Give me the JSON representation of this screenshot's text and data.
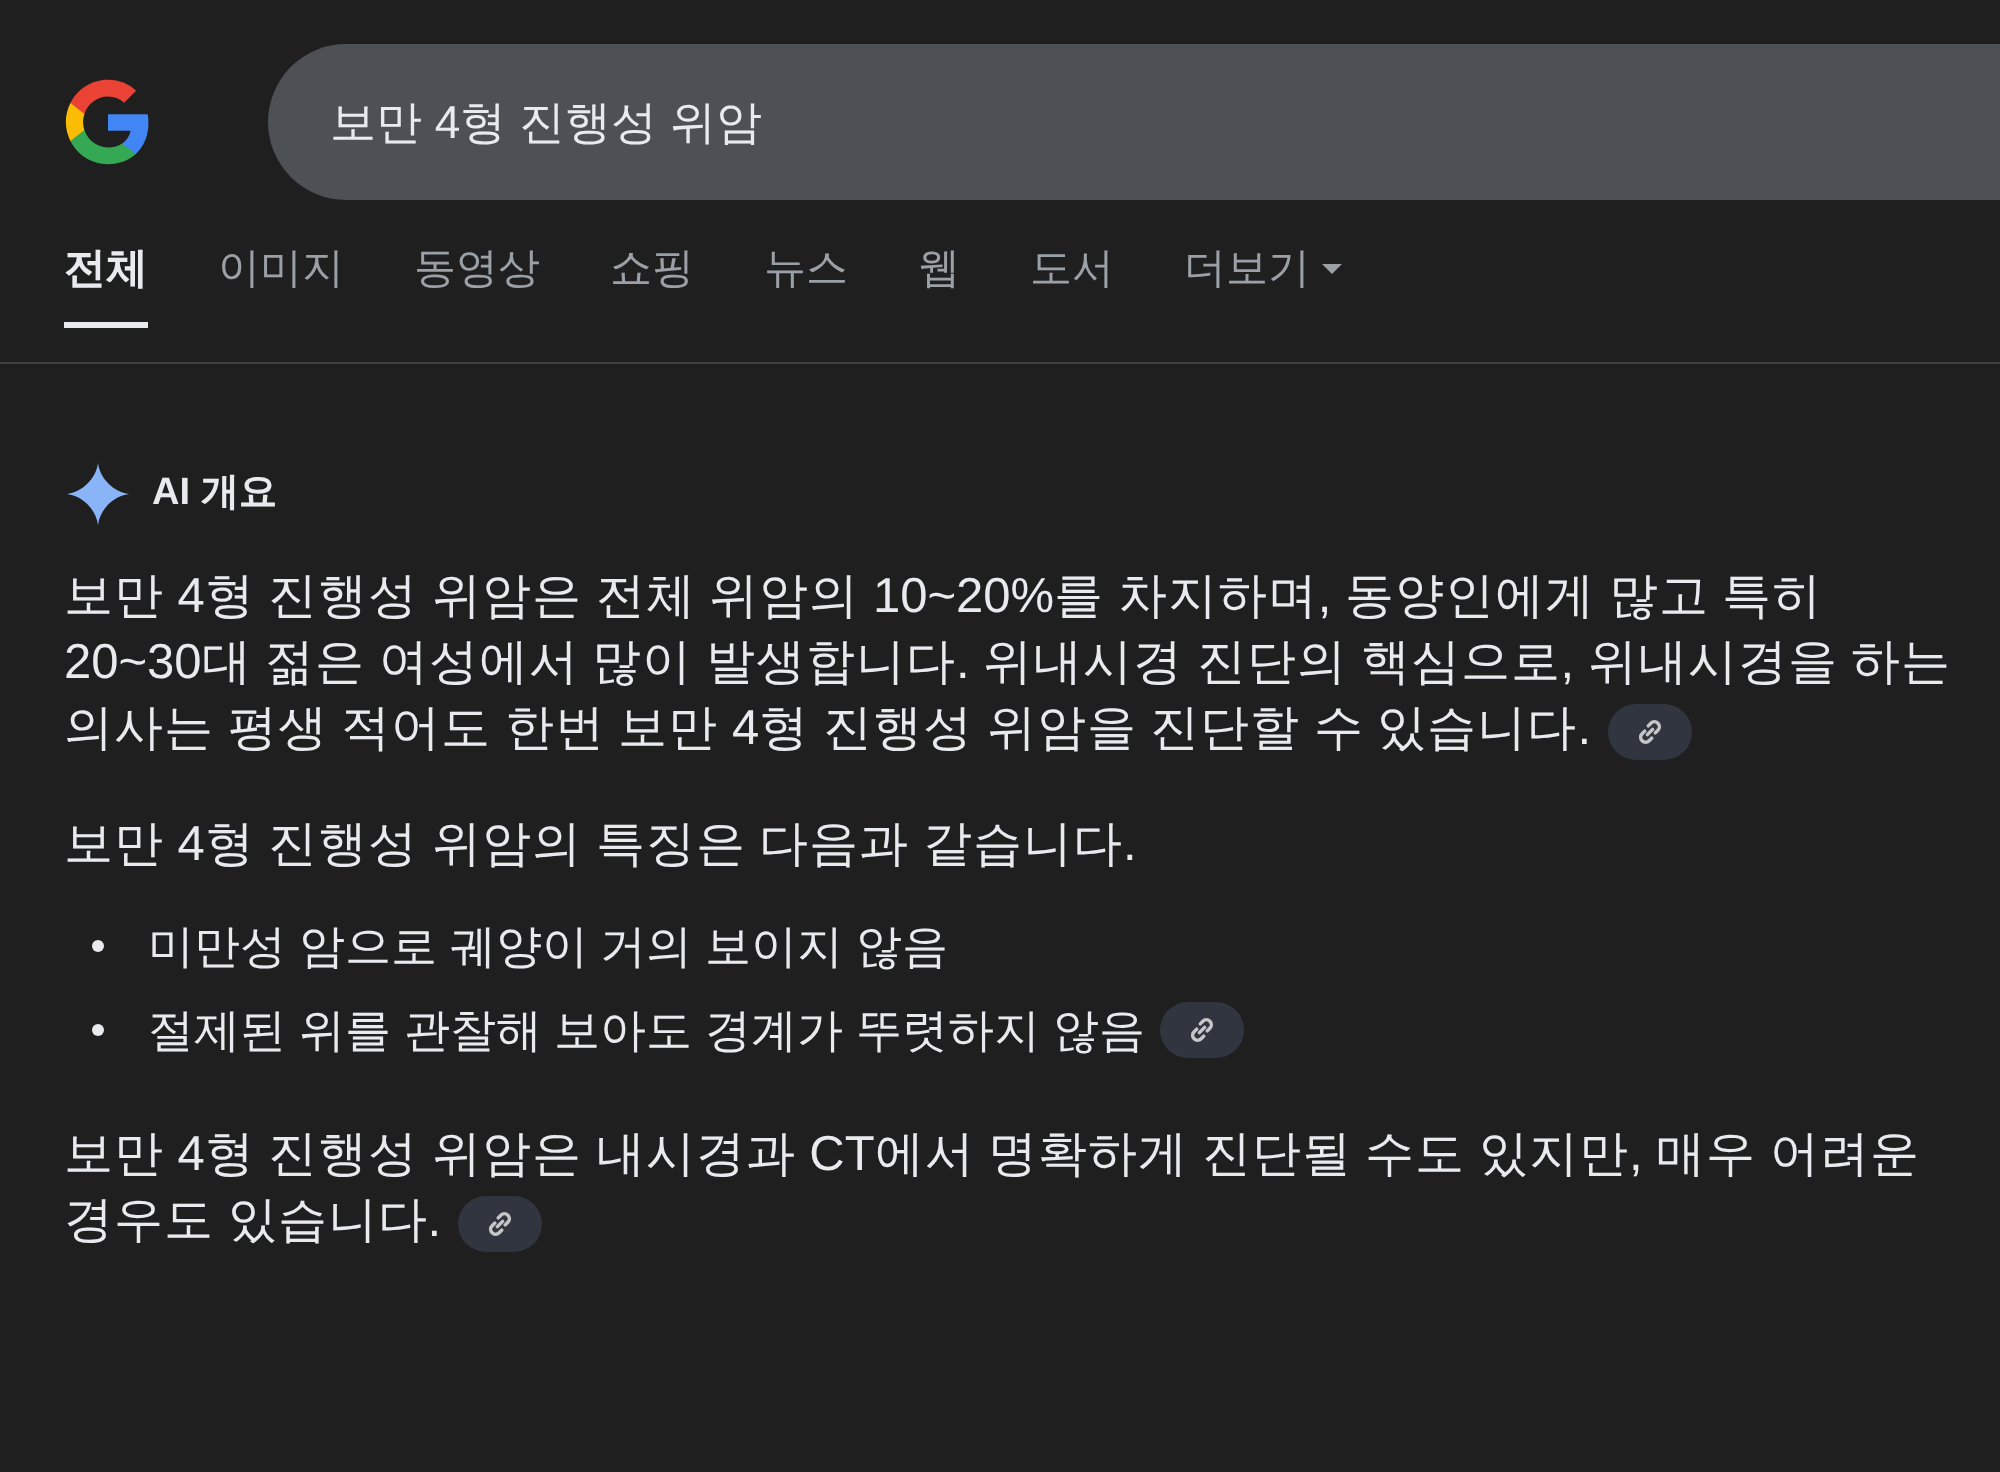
{
  "search": {
    "value": "보만 4형 진행성 위암"
  },
  "tabs": [
    {
      "label": "전체",
      "selected": true,
      "dropdown": false
    },
    {
      "label": "이미지",
      "selected": false,
      "dropdown": false
    },
    {
      "label": "동영상",
      "selected": false,
      "dropdown": false
    },
    {
      "label": "쇼핑",
      "selected": false,
      "dropdown": false
    },
    {
      "label": "뉴스",
      "selected": false,
      "dropdown": false
    },
    {
      "label": "웹",
      "selected": false,
      "dropdown": false
    },
    {
      "label": "도서",
      "selected": false,
      "dropdown": false
    },
    {
      "label": "더보기",
      "selected": false,
      "dropdown": true
    }
  ],
  "ai_overview": {
    "title": "AI 개요",
    "blocks": [
      {
        "kind": "paragraph",
        "text": "보만 4형 진행성 위암은 전체 위암의 10~20%를 차지하며, 동양인에게 많고 특히 20~30대 젊은 여성에서 많이 발생합니다. 위내시경 진단의 핵심으로, 위내시경을 하는 의사는 평생 적어도 한번 보만 4형 진행성 위암을 진단할 수 있습니다.",
        "link_chip": true
      },
      {
        "kind": "paragraph",
        "text": "보만 4형 진행성 위암의 특징은 다음과 같습니다.",
        "link_chip": false
      },
      {
        "kind": "list",
        "items": [
          {
            "text": "미만성 암으로 궤양이 거의 보이지 않음",
            "link_chip": false
          },
          {
            "text": "절제된 위를 관찰해 보아도 경계가 뚜렷하지 않음",
            "link_chip": true
          }
        ]
      },
      {
        "kind": "paragraph",
        "text": "보만 4형 진행성 위암은 내시경과 CT에서 명확하게 진단될 수도 있지만, 매우 어려운 경우도 있습니다.",
        "link_chip": true
      }
    ]
  }
}
